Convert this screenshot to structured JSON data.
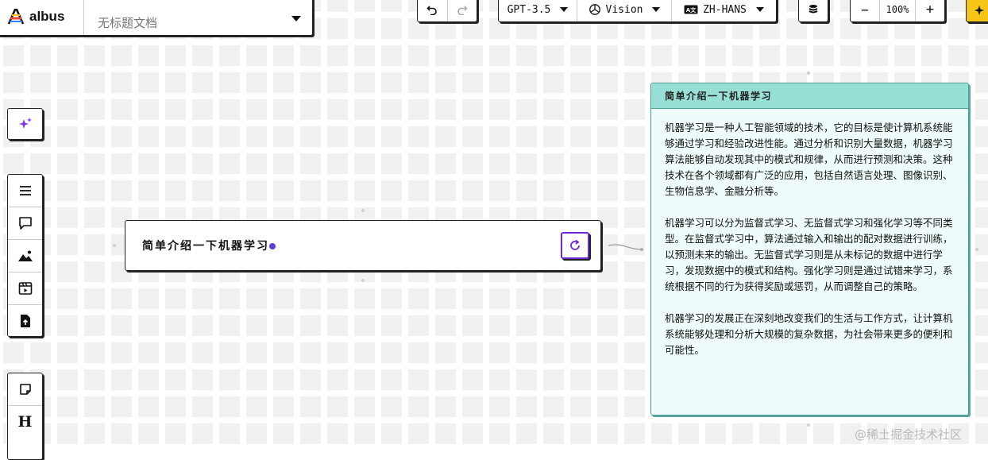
{
  "app": {
    "name": "albus"
  },
  "document": {
    "placeholder": "无标题文档"
  },
  "toolbar": {
    "model": "GPT-3.5",
    "vision": "Vision",
    "language": "ZH-HANS",
    "zoom": "100%",
    "zoom_out": "−",
    "zoom_in": "+"
  },
  "prompt_node": {
    "text": "简单介绍一下机器学习"
  },
  "response": {
    "title": "简单介绍一下机器学习",
    "paragraphs": [
      "机器学习是一种人工智能领域的技术，它的目标是使计算机系统能够通过学习和经验改进性能。通过分析和识别大量数据，机器学习算法能够自动发现其中的模式和规律，从而进行预测和决策。这种技术在各个领域都有广泛的应用，包括自然语言处理、图像识别、生物信息学、金融分析等。",
      "机器学习可以分为监督式学习、无监督式学习和强化学习等不同类型。在监督式学习中，算法通过输入和输出的配对数据进行训练，以预测未来的输出。无监督式学习则是从未标记的数据中进行学习，发现数据中的模式和结构。强化学习则是通过试错来学习，系统根据不同的行为获得奖励或惩罚，从而调整自己的策略。",
      "机器学习的发展正在深刻地改变我们的生活与工作方式，让计算机系统能够处理和分析大规模的复杂数据，为社会带来更多的便利和可能性。"
    ]
  },
  "side_toolbar": {
    "heading_label": "H"
  },
  "watermark": "@稀土掘金技术社区",
  "colors": {
    "accent": "#6d28d9",
    "response_header": "#98dfd6",
    "response_bg": "#eefcfc",
    "highlight": "#f5c518"
  }
}
